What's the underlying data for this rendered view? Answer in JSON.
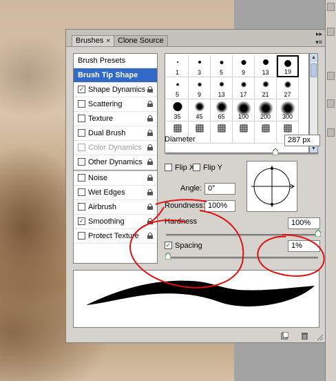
{
  "panel": {
    "tabs": [
      {
        "label": "Brushes",
        "close": "×"
      },
      {
        "label": "Clone Source"
      }
    ],
    "menu_icon": "panel-menu-icon"
  },
  "list": {
    "header": "Brush Presets",
    "selected": "Brush Tip Shape",
    "items": [
      {
        "label": "Shape Dynamics",
        "checked": true,
        "disabled": false
      },
      {
        "label": "Scattering",
        "checked": false,
        "disabled": false
      },
      {
        "label": "Texture",
        "checked": false,
        "disabled": false
      },
      {
        "label": "Dual Brush",
        "checked": false,
        "disabled": false
      },
      {
        "label": "Color Dynamics",
        "checked": false,
        "disabled": true
      },
      {
        "label": "Other Dynamics",
        "checked": false,
        "disabled": false
      },
      {
        "label": "Noise",
        "checked": false,
        "disabled": false
      },
      {
        "label": "Wet Edges",
        "checked": false,
        "disabled": false
      },
      {
        "label": "Airbrush",
        "checked": false,
        "disabled": false
      },
      {
        "label": "Smoothing",
        "checked": true,
        "disabled": false
      },
      {
        "label": "Protect Texture",
        "checked": false,
        "disabled": false
      }
    ]
  },
  "brush_grid": {
    "rows": [
      [
        "1",
        "3",
        "5",
        "9",
        "13",
        "19"
      ],
      [
        "5",
        "9",
        "13",
        "17",
        "21",
        "27"
      ],
      [
        "35",
        "45",
        "65",
        "100",
        "200",
        "300"
      ],
      [
        "",
        "",
        "",
        "",
        "",
        ""
      ]
    ],
    "selected_index": 5
  },
  "controls": {
    "diameter_label": "Diameter",
    "diameter_value": "287 px",
    "diameter_fraction": 0.72,
    "flip_x_label": "Flip X",
    "flip_y_label": "Flip Y",
    "angle_label": "Angle:",
    "angle_value": "0°",
    "roundness_label": "Roundness:",
    "roundness_value": "100%",
    "hardness_label": "Hardness",
    "hardness_value": "100%",
    "hardness_fraction": 1.0,
    "spacing_label": "Spacing",
    "spacing_checked": true,
    "spacing_value": "1%",
    "spacing_fraction": 0.0
  },
  "colors": {
    "selection": "#316ac5",
    "annotation": "#e01010"
  }
}
